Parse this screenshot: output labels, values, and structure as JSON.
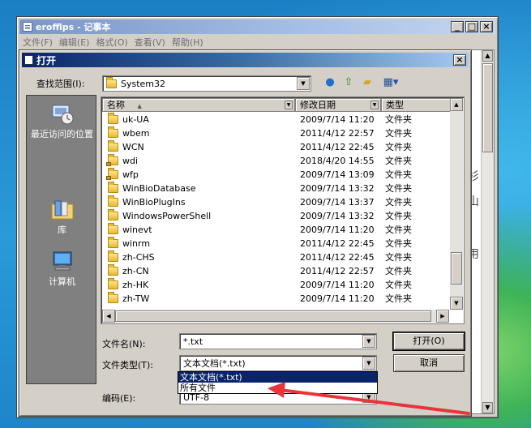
{
  "notepad": {
    "title": "erofflps - 记事本",
    "menu": [
      "文件(F)",
      "编辑(E)",
      "格式(O)",
      "查看(V)",
      "帮助(H)"
    ],
    "text_fragments": [
      "衫",
      "山",
      "用"
    ],
    "window_buttons": [
      "_",
      "□",
      "×"
    ]
  },
  "dialog": {
    "title": "打开",
    "close": "×",
    "lookin_label": "查找范围(I):",
    "lookin_value": "System32",
    "toolbar_icons": [
      "back-icon",
      "up-folder-icon",
      "new-folder-icon",
      "view-menu-icon"
    ],
    "places": [
      {
        "label": "最近访问的位置",
        "icon": "recent-places-icon"
      },
      {
        "label": "库",
        "icon": "libraries-icon"
      },
      {
        "label": "计算机",
        "icon": "computer-icon"
      }
    ],
    "columns": {
      "name": "名称",
      "date": "修改日期",
      "type": "类型"
    },
    "files": [
      {
        "name": "uk-UA",
        "date": "2009/7/14 11:20",
        "type": "文件夹",
        "locked": false
      },
      {
        "name": "wbem",
        "date": "2011/4/12 22:57",
        "type": "文件夹",
        "locked": false
      },
      {
        "name": "WCN",
        "date": "2011/4/12 22:45",
        "type": "文件夹",
        "locked": false
      },
      {
        "name": "wdi",
        "date": "2018/4/20 14:55",
        "type": "文件夹",
        "locked": true
      },
      {
        "name": "wfp",
        "date": "2009/7/14 13:09",
        "type": "文件夹",
        "locked": true
      },
      {
        "name": "WinBioDatabase",
        "date": "2009/7/14 13:32",
        "type": "文件夹",
        "locked": false
      },
      {
        "name": "WinBioPlugIns",
        "date": "2009/7/14 13:37",
        "type": "文件夹",
        "locked": false
      },
      {
        "name": "WindowsPowerShell",
        "date": "2009/7/14 13:32",
        "type": "文件夹",
        "locked": false
      },
      {
        "name": "winevt",
        "date": "2009/7/14 11:20",
        "type": "文件夹",
        "locked": false
      },
      {
        "name": "winrm",
        "date": "2011/4/12 22:45",
        "type": "文件夹",
        "locked": false
      },
      {
        "name": "zh-CHS",
        "date": "2011/4/12 22:45",
        "type": "文件夹",
        "locked": false
      },
      {
        "name": "zh-CN",
        "date": "2011/4/12 22:57",
        "type": "文件夹",
        "locked": false
      },
      {
        "name": "zh-HK",
        "date": "2009/7/14 11:20",
        "type": "文件夹",
        "locked": false
      },
      {
        "name": "zh-TW",
        "date": "2009/7/14 11:20",
        "type": "文件夹",
        "locked": false
      }
    ],
    "filename_label": "文件名(N):",
    "filename_value": "*.txt",
    "filetype_label": "文件类型(T):",
    "filetype_value": "文本文档(*.txt)",
    "filetype_options": [
      "文本文档(*.txt)",
      "所有文件"
    ],
    "encoding_label": "编码(E):",
    "encoding_value": "UTF-8",
    "open_button": "打开(O)",
    "cancel_button": "取消"
  },
  "colors": {
    "dialog_title": "#0a246a",
    "selection": "#0a246a",
    "annotation_arrow": "#e8343a"
  }
}
